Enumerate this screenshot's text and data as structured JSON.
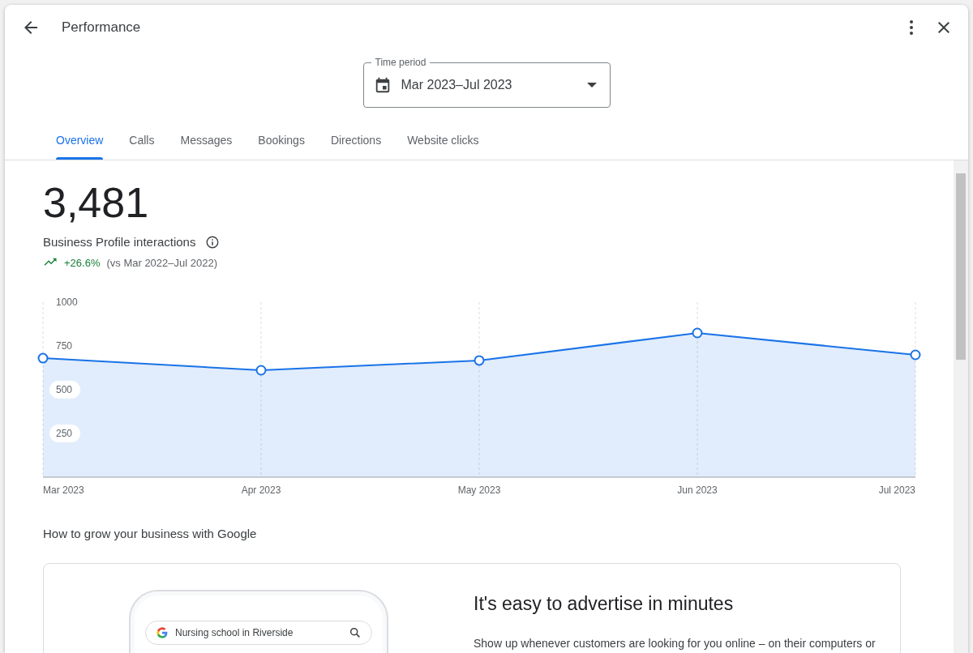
{
  "window": {
    "title": "Performance"
  },
  "time_period": {
    "label": "Time period",
    "value": "Mar 2023–Jul 2023"
  },
  "tabs": [
    {
      "label": "Overview",
      "selected": true
    },
    {
      "label": "Calls",
      "selected": false
    },
    {
      "label": "Messages",
      "selected": false
    },
    {
      "label": "Bookings",
      "selected": false
    },
    {
      "label": "Directions",
      "selected": false
    },
    {
      "label": "Website clicks",
      "selected": false
    }
  ],
  "summary": {
    "total": "3,481",
    "label": "Business Profile interactions",
    "change": "+26.6%",
    "comparison": "(vs Mar 2022–Jul 2022)"
  },
  "chart_data": {
    "type": "area",
    "categories": [
      "Mar 2023",
      "Apr 2023",
      "May 2023",
      "Jun 2023",
      "Jul 2023"
    ],
    "series": [
      {
        "color": "#1a73e8",
        "values": [
          680,
          611,
          667,
          824,
          699
        ]
      }
    ],
    "grid": true,
    "ylim": [
      0,
      1000
    ],
    "yticks": [
      250,
      500,
      750,
      1000
    ]
  },
  "promo": {
    "heading": "How to grow your business with Google",
    "title": "It's easy to advertise in minutes",
    "body": "Show up whenever customers are looking for you online – on their computers or",
    "search_text": "Nursing school in Riverside"
  }
}
